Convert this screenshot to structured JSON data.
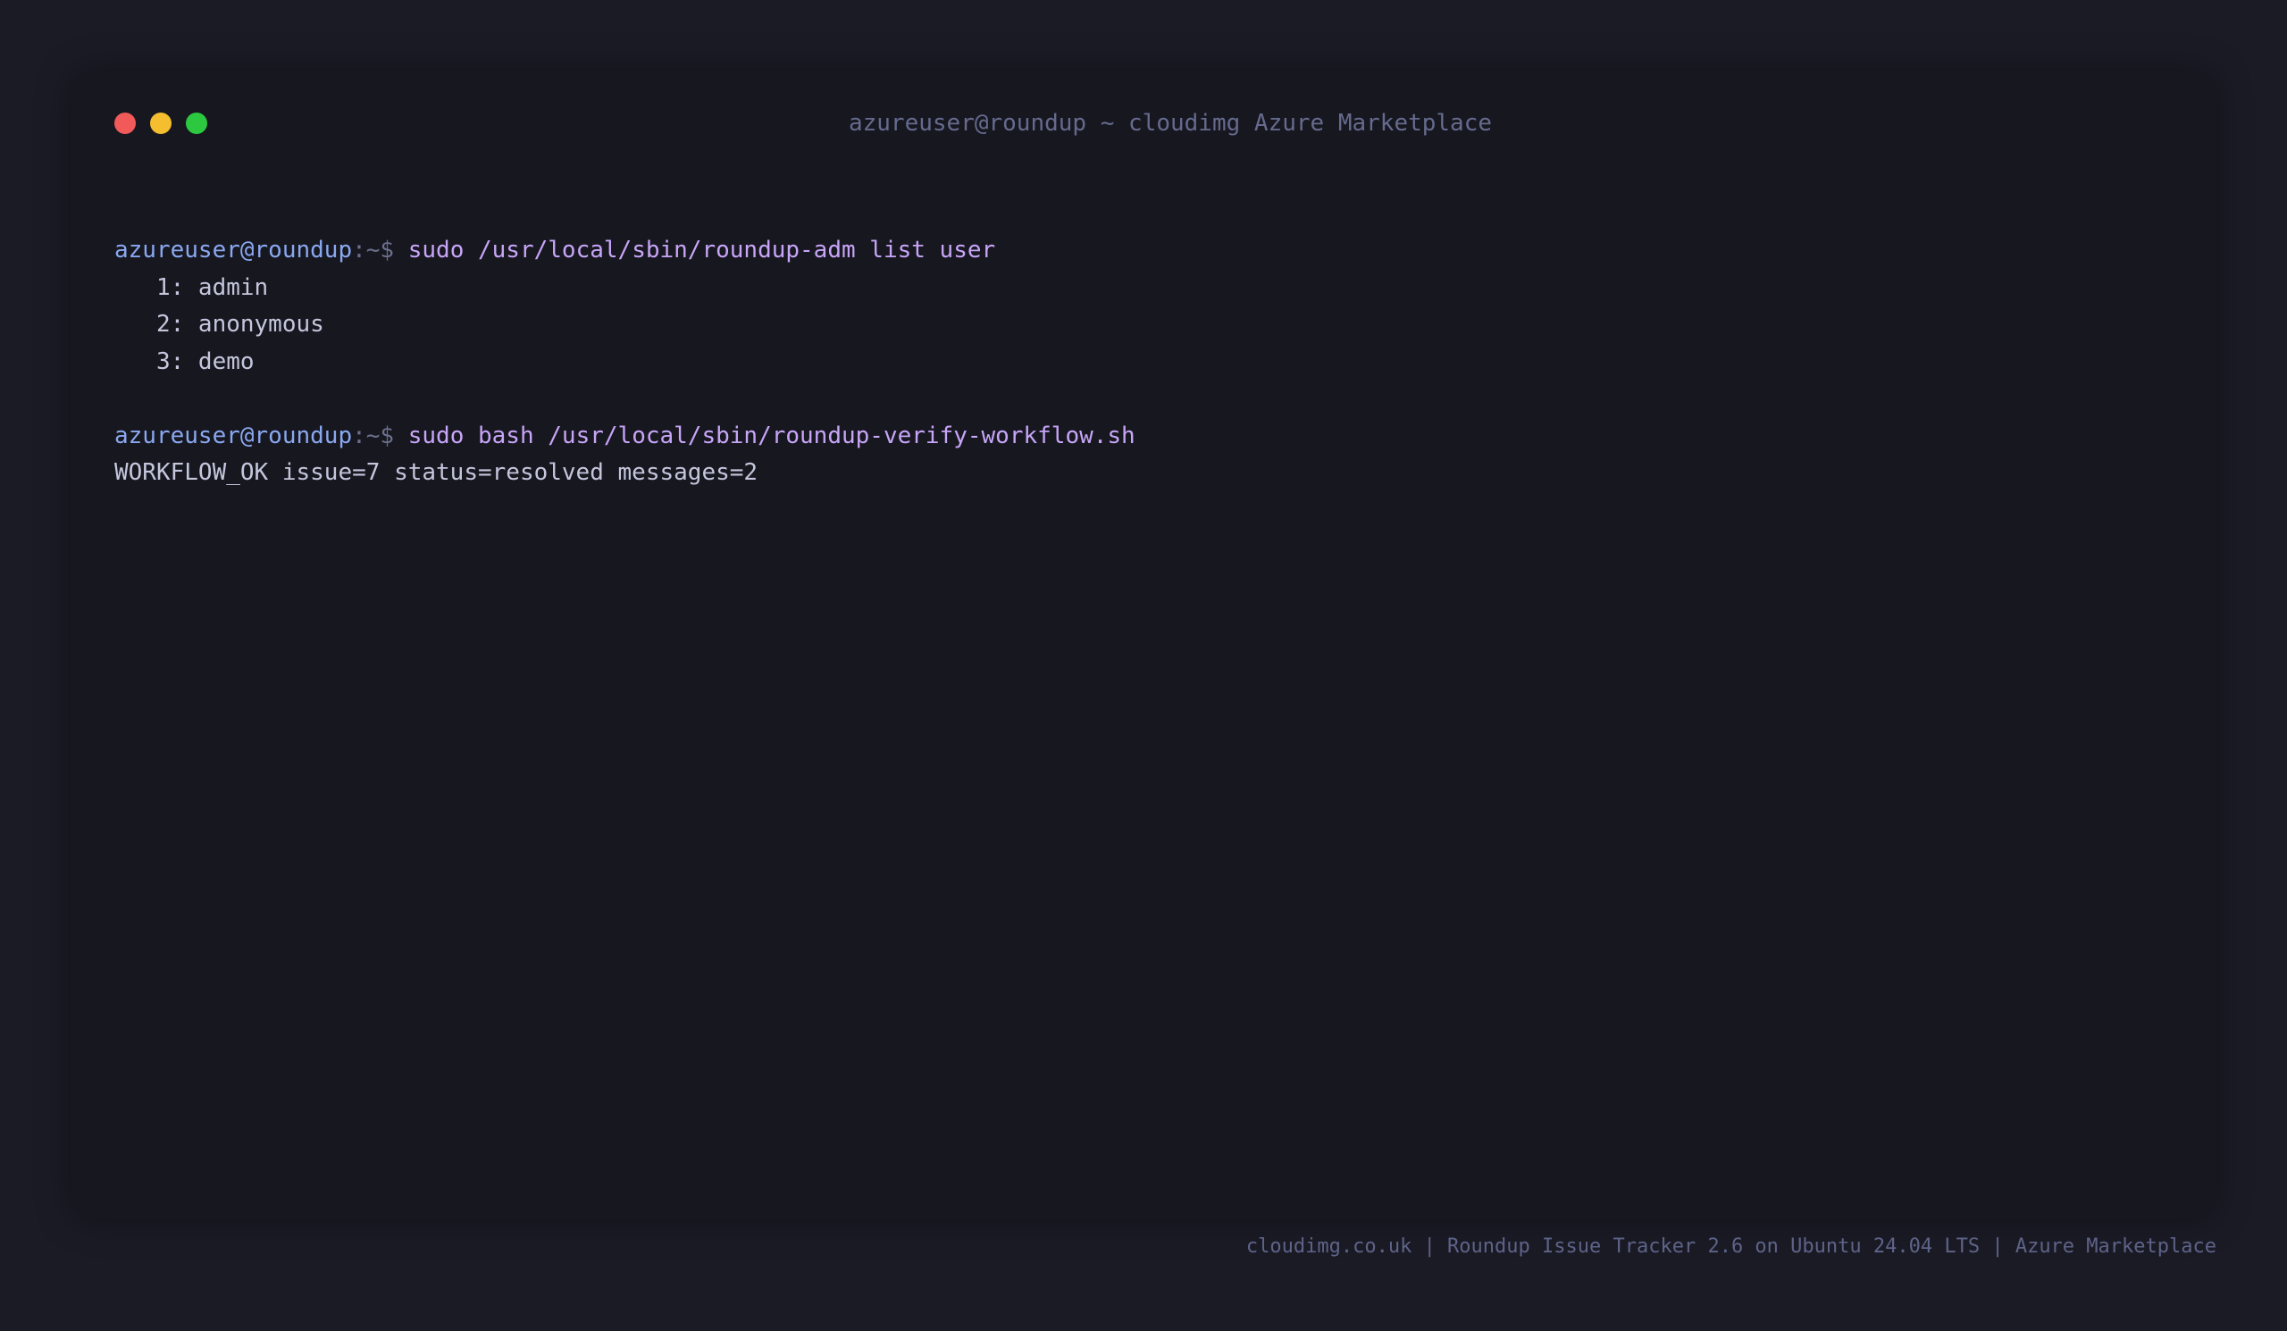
{
  "window": {
    "title": "azureuser@roundup ~ cloudimg Azure Marketplace"
  },
  "terminal": {
    "lines": [
      {
        "type": "prompt",
        "user": "azureuser@roundup",
        "path": ":~$ ",
        "command": "sudo /usr/local/sbin/roundup-adm list user"
      },
      {
        "type": "output",
        "text": "   1: admin"
      },
      {
        "type": "output",
        "text": "   2: anonymous"
      },
      {
        "type": "output",
        "text": "   3: demo"
      },
      {
        "type": "blank"
      },
      {
        "type": "prompt",
        "user": "azureuser@roundup",
        "path": ":~$ ",
        "command": "sudo bash /usr/local/sbin/roundup-verify-workflow.sh"
      },
      {
        "type": "output",
        "text": "WORKFLOW_OK issue=7 status=resolved messages=2"
      }
    ]
  },
  "footer": {
    "text": "cloudimg.co.uk | Roundup Issue Tracker 2.6 on Ubuntu 24.04 LTS | Azure Marketplace"
  },
  "colors": {
    "background": "#1b1b26",
    "terminal_bg": "#171720",
    "prompt_user": "#8aa8f0",
    "prompt_path": "#6b6f8c",
    "command": "#c7a5f7",
    "output": "#c4c6dc",
    "close": "#f25a5a",
    "minimize": "#f5be2e",
    "maximize": "#2cc840"
  }
}
